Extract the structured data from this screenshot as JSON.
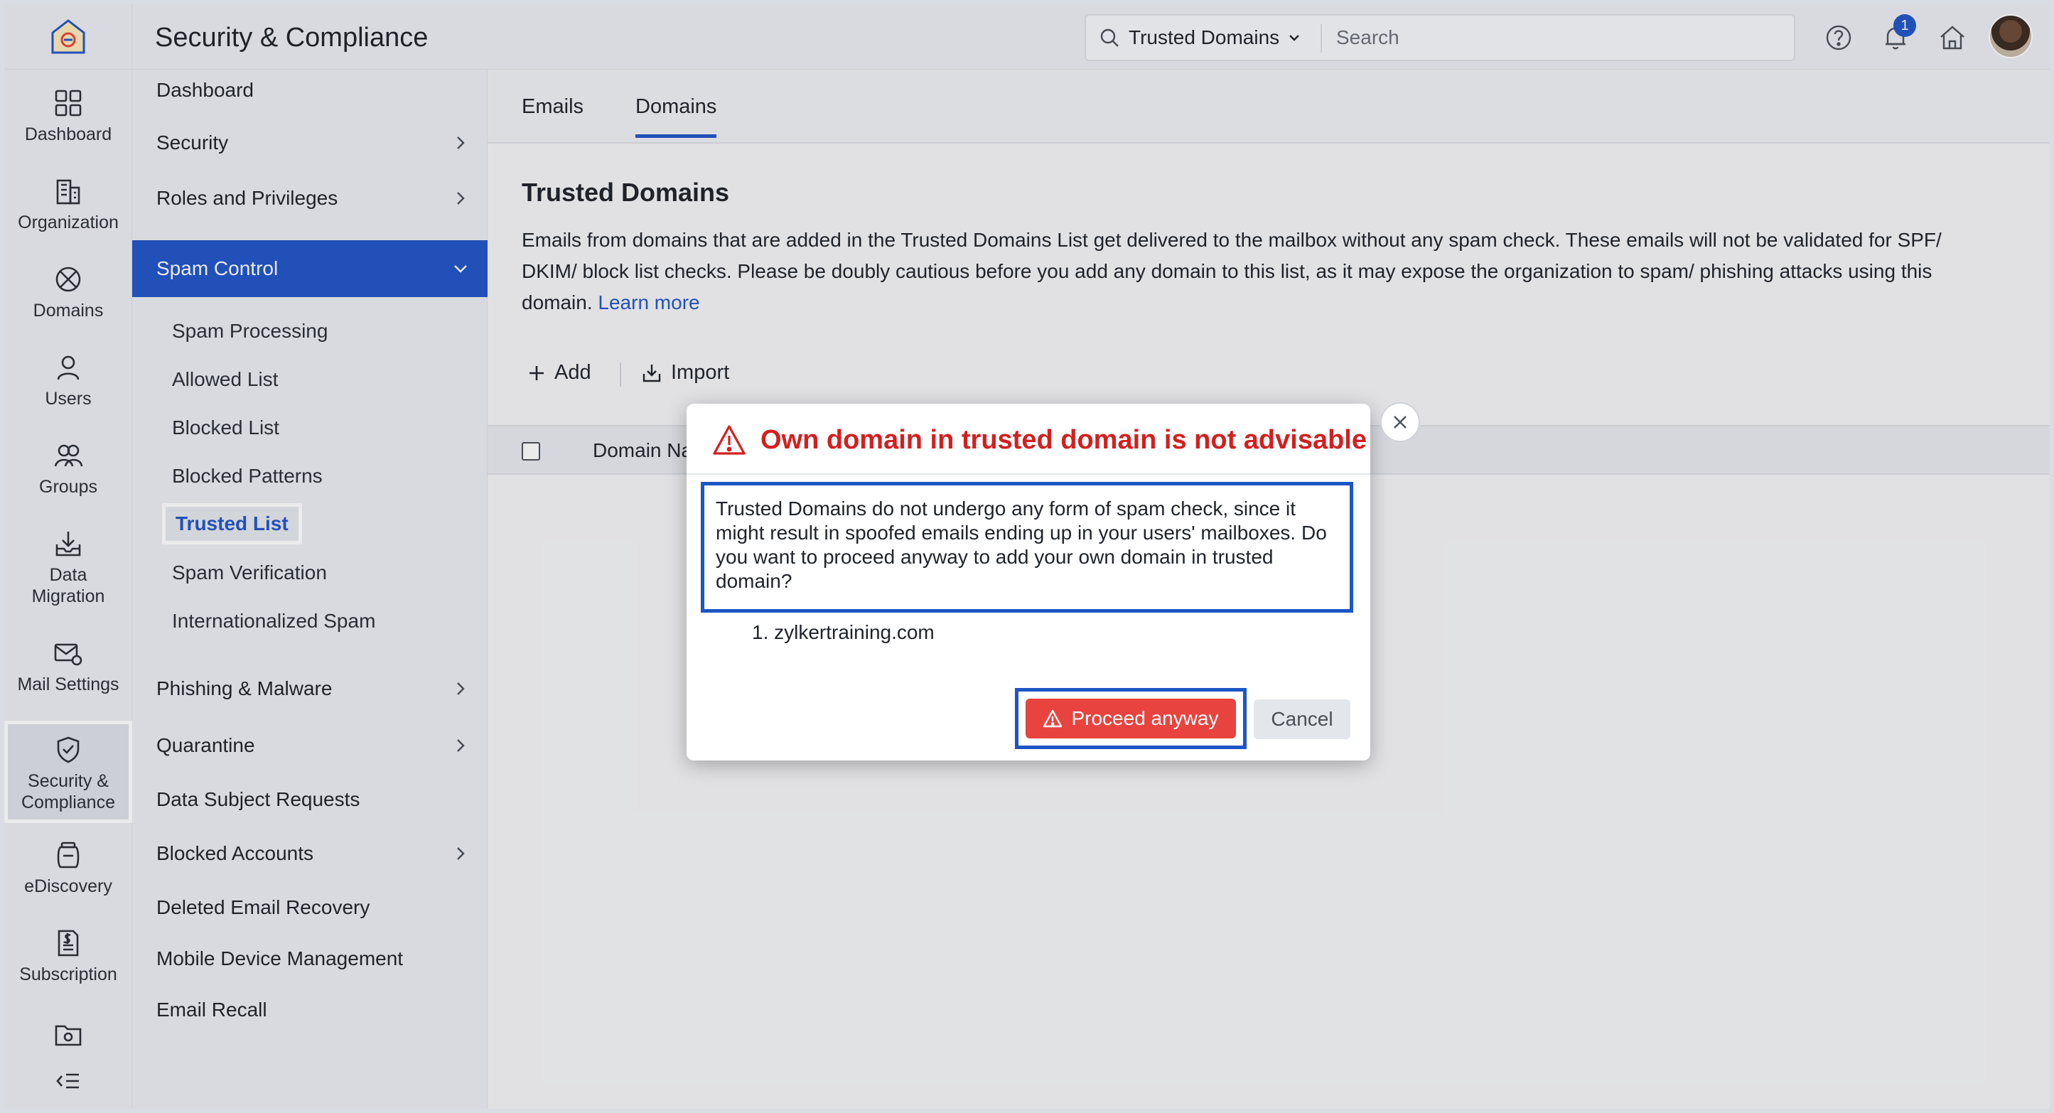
{
  "app": {
    "title": "Security & Compliance"
  },
  "search": {
    "scope": "Trusted Domains",
    "placeholder": "Search"
  },
  "notifications": {
    "count": "1"
  },
  "rail": {
    "items": [
      {
        "label": "Dashboard",
        "icon": "dashboard-icon"
      },
      {
        "label": "Organization",
        "icon": "building-icon"
      },
      {
        "label": "Domains",
        "icon": "globe-icon"
      },
      {
        "label": "Users",
        "icon": "user-icon"
      },
      {
        "label": "Groups",
        "icon": "group-icon"
      },
      {
        "label": "Data Migration",
        "icon": "download-tray-icon"
      },
      {
        "label": "Mail Settings",
        "icon": "mail-gear-icon"
      },
      {
        "label": "Security & Compliance",
        "icon": "shield-check-icon"
      },
      {
        "label": "eDiscovery",
        "icon": "jar-icon"
      },
      {
        "label": "Subscription",
        "icon": "invoice-icon"
      }
    ]
  },
  "nav": {
    "dashboard": "Dashboard",
    "security": "Security",
    "roles": "Roles and Privileges",
    "spam_control": "Spam Control",
    "spam_sub": [
      "Spam Processing",
      "Allowed List",
      "Blocked List",
      "Blocked Patterns",
      "Trusted List",
      "Spam Verification",
      "Internationalized Spam"
    ],
    "phishing": "Phishing & Malware",
    "quarantine": "Quarantine",
    "dsr": "Data Subject Requests",
    "blocked_accounts": "Blocked Accounts",
    "deleted_recovery": "Deleted Email Recovery",
    "mdm": "Mobile Device Management",
    "recall": "Email Recall"
  },
  "main": {
    "tabs": [
      "Emails",
      "Domains"
    ],
    "title": "Trusted Domains",
    "description": "Emails from domains that are added in the Trusted Domains List get delivered to the mailbox without any spam check. These emails will not be validated for SPF/ DKIM/ block list checks. Please be doubly cautious before you add any domain to this list, as it may expose the organization to spam/ phishing attacks using this domain.",
    "learn_more": "Learn more",
    "add": "Add",
    "import": "Import",
    "column_domain": "Domain Na"
  },
  "dialog": {
    "title": "Own domain in trusted domain is not advisable",
    "body": "Trusted Domains do not undergo any form of spam check, since it might result in spoofed emails ending up in your users' mailboxes. Do you want to proceed anyway to add your own domain in trusted domain?",
    "list": [
      "1. zylkertraining.com"
    ],
    "proceed": "Proceed anyway",
    "cancel": "Cancel"
  },
  "colors": {
    "accent": "#2155c7",
    "danger": "#d41f1f",
    "button_danger": "#e8433e"
  }
}
